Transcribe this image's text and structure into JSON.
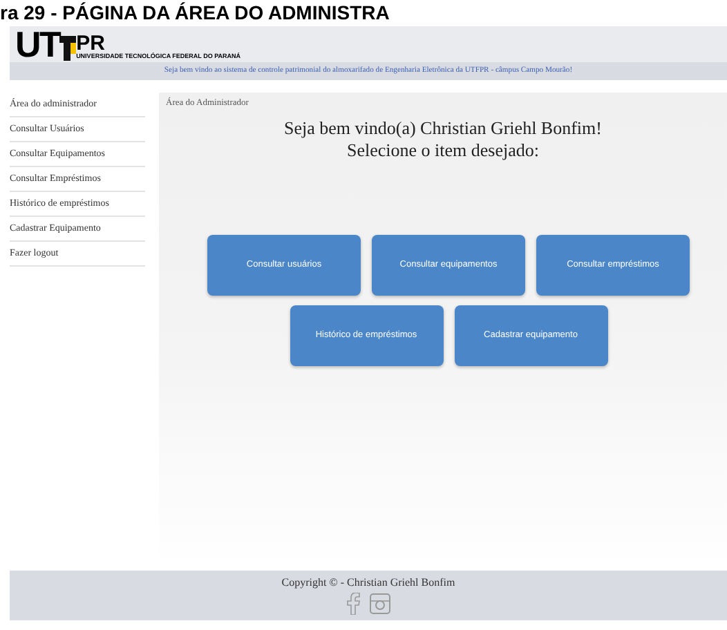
{
  "caption": "ra 29 - PÁGINA DA ÁREA DO ADMINISTRA",
  "header": {
    "logo_text": "UT",
    "logo_pr": "PR",
    "university": "UNIVERSIDADE TECNOLÓGICA FEDERAL DO PARANÁ"
  },
  "banner": "Seja bem vindo ao sistema de controle patrimonial do almoxarifado de Engenharia Eletrônica da UTFPR - câmpus Campo Mourão!",
  "sidebar": {
    "items": [
      {
        "label": "Área do administrador"
      },
      {
        "label": "Consultar Usuários"
      },
      {
        "label": "Consultar Equipamentos"
      },
      {
        "label": "Consultar Empréstimos"
      },
      {
        "label": "Histórico de empréstimos"
      },
      {
        "label": "Cadastrar Equipamento"
      },
      {
        "label": "Fazer logout"
      }
    ]
  },
  "main": {
    "breadcrumb": "Área do Administrador",
    "welcome": "Seja bem vindo(a) Christian Griehl Bonfim!",
    "prompt": "Selecione o item desejado:",
    "buttons": [
      [
        "Consultar usuários",
        "Consultar equipamentos",
        "Consultar empréstimos"
      ],
      [
        "Histórico de empréstimos",
        "Cadastrar equipamento"
      ]
    ]
  },
  "footer": {
    "copyright": "Copyright © - Christian Griehl Bonfim"
  }
}
